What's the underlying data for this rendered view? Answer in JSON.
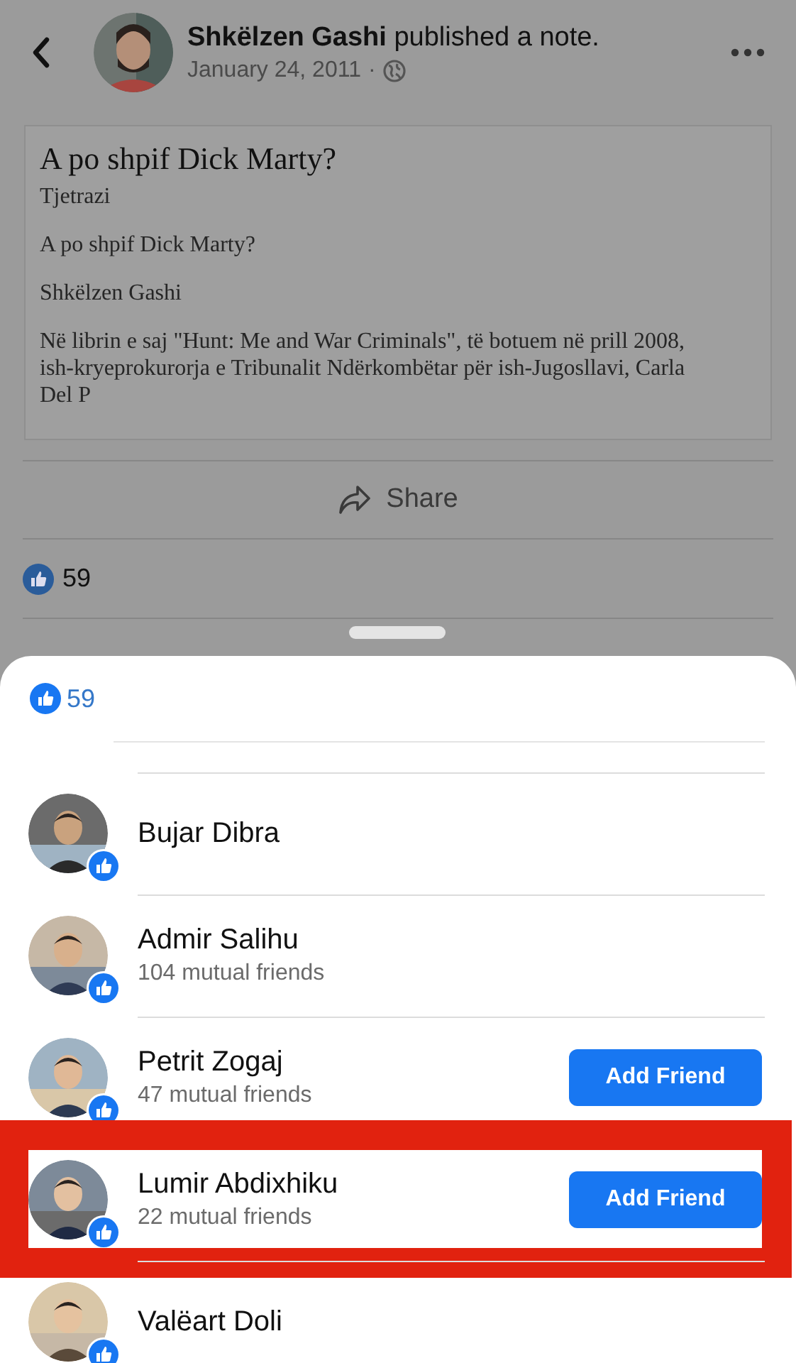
{
  "header": {
    "author": "Shkëlzen Gashi",
    "action": "published a note.",
    "date": "January 24, 2011",
    "separator": "·"
  },
  "note": {
    "title": "A po shpif Dick Marty?",
    "paragraphs": [
      "Tjetrazi",
      "A po shpif Dick Marty?",
      "Shkëlzen Gashi",
      "Në librin e saj \"Hunt: Me and War Criminals\", të botuem në prill 2008, ish-kryeprokurorja e Tribunalit Ndërkombëtar për ish-Jugosllavi, Carla Del P"
    ]
  },
  "share_button": "Share",
  "like_count": "59",
  "reactions_sheet": {
    "like_count": "59",
    "people": [
      {
        "name": "Bujar Dibra",
        "highlighted": false
      },
      {
        "name": "Admir Salihu",
        "mutual_friends": "104 mutual friends",
        "highlighted": false
      },
      {
        "name": "Petrit Zogaj",
        "mutual_friends": "47 mutual friends",
        "button": "Add Friend",
        "highlighted": false
      },
      {
        "name": "Lumir Abdixhiku",
        "mutual_friends": "22 mutual friends",
        "button": "Add Friend",
        "highlighted": true
      },
      {
        "name": "Valëart Doli",
        "highlighted": false
      }
    ]
  }
}
